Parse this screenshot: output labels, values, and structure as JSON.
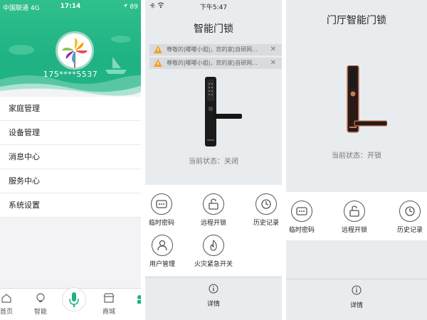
{
  "profile_screen": {
    "status": {
      "carrier": "中国联通 4G",
      "time": "17:14",
      "battery": "89"
    },
    "phone": "175****5537",
    "menu": [
      "家庭管理",
      "设备管理",
      "消息中心",
      "服务中心",
      "系统设置"
    ],
    "tabs": [
      "首页",
      "智能",
      "商城"
    ],
    "accent": "#1fb284"
  },
  "lock_screen_1": {
    "status": {
      "left": "卡",
      "time": "下午5:47"
    },
    "title": "智能门锁",
    "notices": [
      "尊敬的|嘟嘟小姐|，您的家|自研网...",
      "尊敬的|嘟嘟小姐|，您的家|自研网..."
    ],
    "state": "当前状态：关闭",
    "actions": [
      "临时密码",
      "远程开锁",
      "历史记录",
      "用户管理",
      "火灾紧急开关"
    ],
    "detail": "详情"
  },
  "lock_screen_2": {
    "title": "门厅智能门锁",
    "state": "当前状态：开锁",
    "actions": [
      "临时密码",
      "远程开锁",
      "历史记录"
    ],
    "detail": "详情"
  }
}
